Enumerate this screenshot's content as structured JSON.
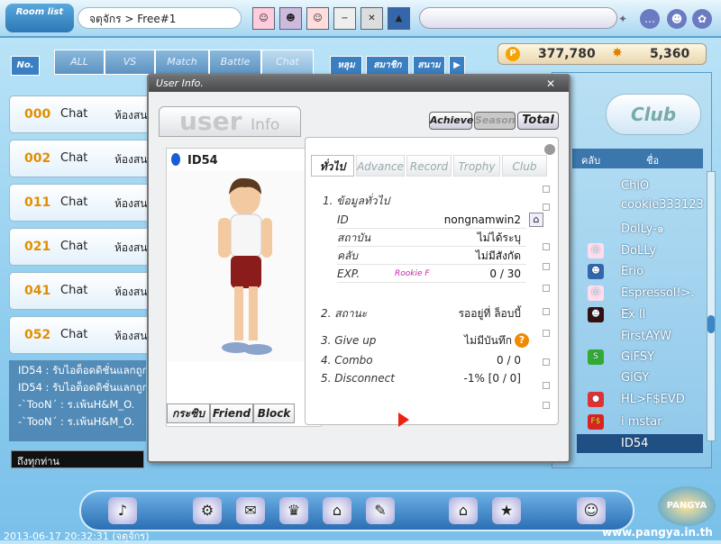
{
  "top": {
    "room_list": "Room list",
    "breadcrumb": "จตุจักร > Free#1",
    "coins": "377,780",
    "cookies": "5,360"
  },
  "filters": {
    "no": "No.",
    "all": "ALL",
    "vs": "VS",
    "match": "Match",
    "battle": "Battle",
    "chat": "Chat",
    "tab1": "หลุม",
    "tab2": "สมาชิก",
    "tab3": "สนาม",
    "next": "▶"
  },
  "rooms": [
    {
      "num": "000",
      "type": "Chat",
      "name": "ห้องสน"
    },
    {
      "num": "002",
      "type": "Chat",
      "name": "ห้องสน"
    },
    {
      "num": "011",
      "type": "Chat",
      "name": "ห้องสน"
    },
    {
      "num": "021",
      "type": "Chat",
      "name": "ห้องสน"
    },
    {
      "num": "041",
      "type": "Chat",
      "name": "ห้องสน"
    },
    {
      "num": "052",
      "type": "Chat",
      "name": "ห้องสน"
    }
  ],
  "chatlog": [
    "ID54 : รับไอต็อดดิชั่นแลกถูก",
    "ID54 : รับไอต็อดดิชั่นแลกถูก",
    "-`ToоN´ : ร.เพ้นH&M_O.",
    "-`ToоN´ : ร.เพ้นH&M_O."
  ],
  "chat_target": "ถึงทุกท่าน",
  "right_panel": {
    "club": "Club",
    "col_club": "คลับ",
    "col_name": "ชื่อ",
    "players": [
      "ChiO",
      "cookie333123",
      "DolLy-๑",
      "DoLLy",
      "Erio",
      "Espressol!>.<",
      "Ex ll",
      "FirstAYW",
      "GiFSY",
      "GiGY",
      "HL>F$EVD",
      "i mstar",
      "ID54"
    ]
  },
  "dialog": {
    "title": "User Info.",
    "close": "✕",
    "user_title": "user",
    "user_sub": "Info",
    "season_tabs": [
      "Achieve.",
      "Season",
      "Total"
    ],
    "player_id": "ID54",
    "actions": [
      "กระซิบ",
      "Friend",
      "Block"
    ],
    "info_tabs": [
      "ทั่วไป",
      "Advance",
      "Record",
      "Trophy",
      "Club"
    ],
    "sec1": "1. ข้อมูลทั่วไป",
    "rows": [
      {
        "k": "ID",
        "v": "nongnamwin2"
      },
      {
        "k": "สถาบัน",
        "v": "ไม่ได้ระบุ"
      },
      {
        "k": "คลับ",
        "v": "ไม่มีสังกัด"
      },
      {
        "k": "EXP.",
        "v": "0 / 30"
      }
    ],
    "rank": "Rookie F",
    "sec2": "2. สถานะ",
    "status": "รออยู่ที่ ล็อบบี้",
    "stats": [
      {
        "k": "3. Give up",
        "v": "ไม่มีบันทึก"
      },
      {
        "k": "4. Combo",
        "v": "0 / 0"
      },
      {
        "k": "5. Disconnect",
        "v": "-1% [0 / 0]"
      }
    ]
  },
  "footer": {
    "datetime": "2013-06-17 20:32:31 (จตุจักร)",
    "website": "www.pangya.in.th",
    "logo": "PANGYA"
  }
}
